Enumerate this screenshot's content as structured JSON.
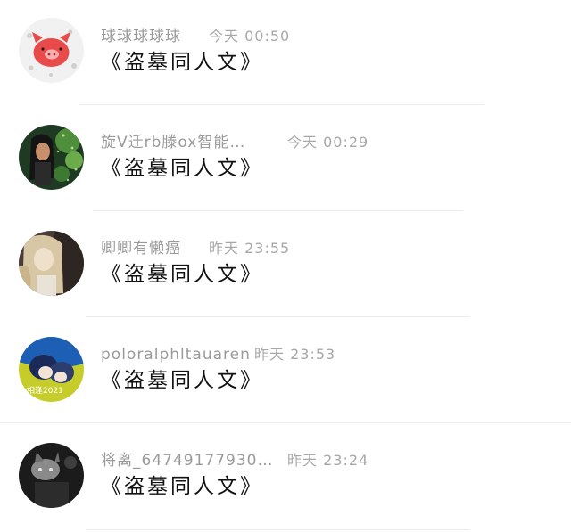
{
  "comments": [
    {
      "name": "球球球球球",
      "time": "今天 00:50",
      "message": "《盗墓同人文》",
      "avatar": "pig-avatar"
    },
    {
      "name": "旋V迁rb滕ox智能…",
      "time": "今天 00:29",
      "message": "《盗墓同人文》",
      "avatar": "anime-girl-green-avatar"
    },
    {
      "name": "卿卿有懒癌",
      "time": "昨天 23:55",
      "message": "《盗墓同人文》",
      "avatar": "anime-girl-blonde-avatar"
    },
    {
      "name": "poloralphltauaren",
      "time": "昨天 23:53",
      "message": "《盗墓同人文》",
      "avatar": "anime-couple-blue-avatar"
    },
    {
      "name": "将离_64749177930…",
      "time": "昨天 23:24",
      "message": "《盗墓同人文》",
      "avatar": "cat-dark-avatar"
    }
  ],
  "avatar_badge_text": "相逢2021",
  "colors": {
    "name": "#9a9a9a",
    "time": "#a8a8a8",
    "message": "#111111",
    "divider": "#ececec",
    "pig": "#e94a4a"
  }
}
